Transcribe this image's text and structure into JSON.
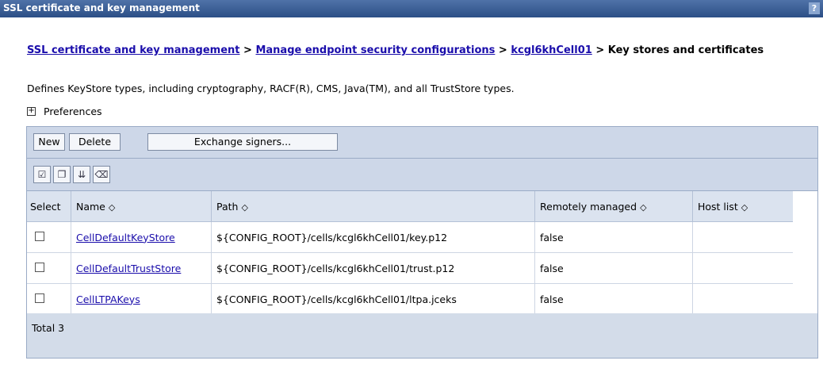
{
  "title": "SSL certificate and key management",
  "help_glyph": "?",
  "breadcrumb": {
    "items": [
      "SSL certificate and key management",
      "Manage endpoint security configurations",
      "kcgl6khCell01"
    ],
    "separator": ">",
    "current": "Key stores and certificates"
  },
  "description": "Defines KeyStore types, including cryptography, RACF(R), CMS, Java(TM), and all TrustStore types.",
  "preferences": {
    "expander": "+",
    "label": "Preferences"
  },
  "buttons": {
    "new": "New",
    "delete": "Delete",
    "exchange": "Exchange signers..."
  },
  "icons": [
    "select-all-icon",
    "deselect-all-icon",
    "show-filter-icon",
    "clear-filter-icon"
  ],
  "table": {
    "headers": [
      "Select",
      "Name",
      "Path",
      "Remotely managed",
      "Host list"
    ],
    "sort_glyph": "◇",
    "rows": [
      {
        "name": "CellDefaultKeyStore",
        "path": "${CONFIG_ROOT}/cells/kcgl6khCell01/key.p12",
        "remote": "false",
        "hosts": ""
      },
      {
        "name": "CellDefaultTrustStore",
        "path": "${CONFIG_ROOT}/cells/kcgl6khCell01/trust.p12",
        "remote": "false",
        "hosts": ""
      },
      {
        "name": "CellLTPAKeys",
        "path": "${CONFIG_ROOT}/cells/kcgl6khCell01/ltpa.jceks",
        "remote": "false",
        "hosts": ""
      }
    ],
    "total": "Total 3"
  }
}
